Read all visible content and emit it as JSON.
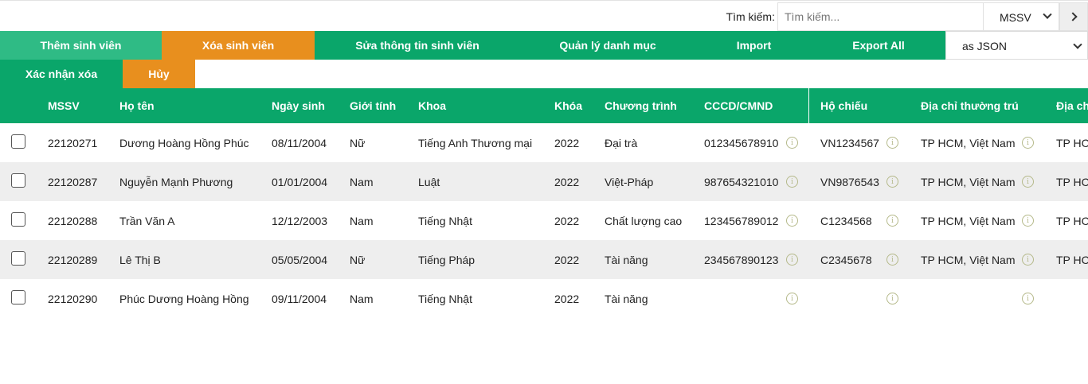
{
  "search": {
    "label": "Tìm kiếm:",
    "placeholder": "Tìm kiếm...",
    "field_selected": "MSSV"
  },
  "toolbar": {
    "add": "Thêm sinh viên",
    "delete": "Xóa sinh viên",
    "edit": "Sửa thông tin sinh viên",
    "manage": "Quản lý danh mục",
    "import": "Import",
    "export_all": "Export All",
    "export_format": "as JSON"
  },
  "confirm": {
    "confirm_delete": "Xác nhận xóa",
    "cancel": "Hủy"
  },
  "table": {
    "headers": {
      "mssv": "MSSV",
      "name": "Họ tên",
      "dob": "Ngày sinh",
      "gender": "Giới tính",
      "faculty": "Khoa",
      "cohort": "Khóa",
      "program": "Chương trình",
      "id_card": "CCCD/CMND",
      "passport": "Hộ chiếu",
      "perm_addr": "Địa chỉ thường trú",
      "addr2": "Địa chỉ tạm trú"
    },
    "rows": [
      {
        "mssv": "22120271",
        "name": "Dương Hoàng Hồng Phúc",
        "dob": "08/11/2004",
        "gender": "Nữ",
        "faculty": "Tiếng Anh Thương mại",
        "cohort": "2022",
        "program": "Đại trà",
        "id_card": "012345678910",
        "passport": "VN1234567",
        "perm_addr": "TP HCM, Việt Nam",
        "addr2": "TP HCM"
      },
      {
        "mssv": "22120287",
        "name": "Nguyễn Mạnh Phương",
        "dob": "01/01/2004",
        "gender": "Nam",
        "faculty": "Luật",
        "cohort": "2022",
        "program": "Việt-Pháp",
        "id_card": "987654321010",
        "passport": "VN9876543",
        "perm_addr": "TP HCM, Việt Nam",
        "addr2": "TP HCM"
      },
      {
        "mssv": "22120288",
        "name": "Trần Văn A",
        "dob": "12/12/2003",
        "gender": "Nam",
        "faculty": "Tiếng Nhật",
        "cohort": "2022",
        "program": "Chất lượng cao",
        "id_card": "123456789012",
        "passport": "C1234568",
        "perm_addr": "TP HCM, Việt Nam",
        "addr2": "TP HCM"
      },
      {
        "mssv": "22120289",
        "name": "Lê Thị B",
        "dob": "05/05/2004",
        "gender": "Nữ",
        "faculty": "Tiếng Pháp",
        "cohort": "2022",
        "program": "Tài năng",
        "id_card": "234567890123",
        "passport": "C2345678",
        "perm_addr": "TP HCM, Việt Nam",
        "addr2": "TP HCM"
      },
      {
        "mssv": "22120290",
        "name": "Phúc Dương Hoàng Hồng",
        "dob": "09/11/2004",
        "gender": "Nam",
        "faculty": "Tiếng Nhật",
        "cohort": "2022",
        "program": "Tài năng",
        "id_card": "",
        "passport": "",
        "perm_addr": "",
        "addr2": ""
      }
    ]
  }
}
